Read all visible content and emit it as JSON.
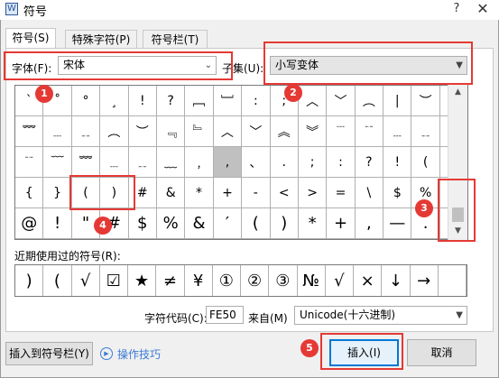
{
  "window": {
    "title": "符号",
    "help": "?",
    "close": "✕"
  },
  "tabs": [
    {
      "label": "符号(S)"
    },
    {
      "label": "特殊字符(P)"
    },
    {
      "label": "符号栏(T)"
    }
  ],
  "font": {
    "label": "字体(F):",
    "value": "宋体"
  },
  "subset": {
    "label": "子集(U):",
    "value": "小写变体"
  },
  "grid": {
    "rows": [
      [
        "`",
        "˚",
        "°",
        "¸",
        "!",
        "?",
        "﹇",
        "﹈",
        ":",
        ";",
        "︿",
        "﹀",
        "︵",
        "|",
        "︶",
        "﹋"
      ],
      [
        "﹌",
        "﹍",
        "﹎",
        "︵",
        "︶",
        "﹃",
        "﹄",
        "︿",
        "﹀",
        "︽",
        "︾",
        "﹉",
        "﹊",
        "﹍",
        "﹎",
        "﹉"
      ],
      [
        "﹊",
        "﹋",
        "﹌",
        "﹍",
        "﹎",
        "﹏",
        "﹐",
        ",",
        "、",
        ".",
        ";",
        ":",
        "?",
        "!",
        "(",
        ")"
      ],
      [
        "{",
        "}",
        "(",
        ")",
        "#",
        "&",
        "*",
        "+",
        "-",
        "<",
        ">",
        "=",
        "\\",
        "$",
        "%",
        "@"
      ],
      [
        "@",
        "!",
        "\"",
        "#",
        "$",
        "%",
        "&",
        "′",
        "(",
        ")",
        "*",
        "+",
        ",",
        "—",
        ".",
        "/"
      ]
    ],
    "selected_index": 39
  },
  "recent": {
    "label": "近期使用过的符号(R):",
    "symbols": [
      ")",
      "(",
      "√",
      "☑",
      "★",
      "≠",
      "¥",
      "①",
      "②",
      "③",
      "№",
      "√",
      "×",
      "↓",
      "→",
      ""
    ]
  },
  "code": {
    "label": "字符代码(C):",
    "value": "FE50"
  },
  "from": {
    "label": "来自(M)",
    "value": "Unicode(十六进制)"
  },
  "buttons": {
    "insert_toolbar": "插入到符号栏(Y)",
    "tips": "操作技巧",
    "insert": "插入(I)",
    "cancel": "取消"
  },
  "annotations": [
    "1",
    "2",
    "3",
    "4",
    "5"
  ],
  "colors": {
    "annotation": "#e53935",
    "accent": "#0078d7",
    "link": "#3a7bd5"
  }
}
